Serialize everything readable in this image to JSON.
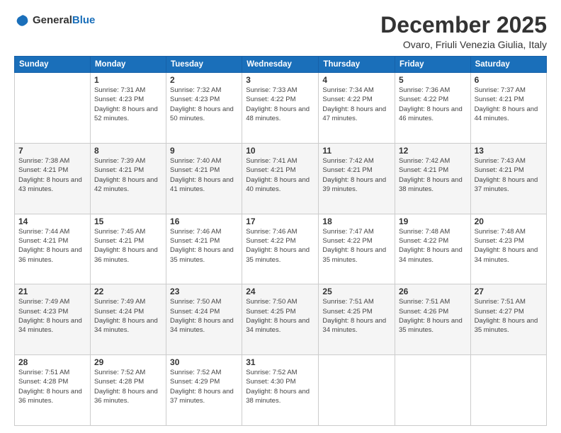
{
  "logo": {
    "general": "General",
    "blue": "Blue"
  },
  "header": {
    "month": "December 2025",
    "location": "Ovaro, Friuli Venezia Giulia, Italy"
  },
  "days_of_week": [
    "Sunday",
    "Monday",
    "Tuesday",
    "Wednesday",
    "Thursday",
    "Friday",
    "Saturday"
  ],
  "weeks": [
    [
      {
        "num": "",
        "sunrise": "",
        "sunset": "",
        "daylight": ""
      },
      {
        "num": "1",
        "sunrise": "Sunrise: 7:31 AM",
        "sunset": "Sunset: 4:23 PM",
        "daylight": "Daylight: 8 hours and 52 minutes."
      },
      {
        "num": "2",
        "sunrise": "Sunrise: 7:32 AM",
        "sunset": "Sunset: 4:23 PM",
        "daylight": "Daylight: 8 hours and 50 minutes."
      },
      {
        "num": "3",
        "sunrise": "Sunrise: 7:33 AM",
        "sunset": "Sunset: 4:22 PM",
        "daylight": "Daylight: 8 hours and 48 minutes."
      },
      {
        "num": "4",
        "sunrise": "Sunrise: 7:34 AM",
        "sunset": "Sunset: 4:22 PM",
        "daylight": "Daylight: 8 hours and 47 minutes."
      },
      {
        "num": "5",
        "sunrise": "Sunrise: 7:36 AM",
        "sunset": "Sunset: 4:22 PM",
        "daylight": "Daylight: 8 hours and 46 minutes."
      },
      {
        "num": "6",
        "sunrise": "Sunrise: 7:37 AM",
        "sunset": "Sunset: 4:21 PM",
        "daylight": "Daylight: 8 hours and 44 minutes."
      }
    ],
    [
      {
        "num": "7",
        "sunrise": "Sunrise: 7:38 AM",
        "sunset": "Sunset: 4:21 PM",
        "daylight": "Daylight: 8 hours and 43 minutes."
      },
      {
        "num": "8",
        "sunrise": "Sunrise: 7:39 AM",
        "sunset": "Sunset: 4:21 PM",
        "daylight": "Daylight: 8 hours and 42 minutes."
      },
      {
        "num": "9",
        "sunrise": "Sunrise: 7:40 AM",
        "sunset": "Sunset: 4:21 PM",
        "daylight": "Daylight: 8 hours and 41 minutes."
      },
      {
        "num": "10",
        "sunrise": "Sunrise: 7:41 AM",
        "sunset": "Sunset: 4:21 PM",
        "daylight": "Daylight: 8 hours and 40 minutes."
      },
      {
        "num": "11",
        "sunrise": "Sunrise: 7:42 AM",
        "sunset": "Sunset: 4:21 PM",
        "daylight": "Daylight: 8 hours and 39 minutes."
      },
      {
        "num": "12",
        "sunrise": "Sunrise: 7:42 AM",
        "sunset": "Sunset: 4:21 PM",
        "daylight": "Daylight: 8 hours and 38 minutes."
      },
      {
        "num": "13",
        "sunrise": "Sunrise: 7:43 AM",
        "sunset": "Sunset: 4:21 PM",
        "daylight": "Daylight: 8 hours and 37 minutes."
      }
    ],
    [
      {
        "num": "14",
        "sunrise": "Sunrise: 7:44 AM",
        "sunset": "Sunset: 4:21 PM",
        "daylight": "Daylight: 8 hours and 36 minutes."
      },
      {
        "num": "15",
        "sunrise": "Sunrise: 7:45 AM",
        "sunset": "Sunset: 4:21 PM",
        "daylight": "Daylight: 8 hours and 36 minutes."
      },
      {
        "num": "16",
        "sunrise": "Sunrise: 7:46 AM",
        "sunset": "Sunset: 4:21 PM",
        "daylight": "Daylight: 8 hours and 35 minutes."
      },
      {
        "num": "17",
        "sunrise": "Sunrise: 7:46 AM",
        "sunset": "Sunset: 4:22 PM",
        "daylight": "Daylight: 8 hours and 35 minutes."
      },
      {
        "num": "18",
        "sunrise": "Sunrise: 7:47 AM",
        "sunset": "Sunset: 4:22 PM",
        "daylight": "Daylight: 8 hours and 35 minutes."
      },
      {
        "num": "19",
        "sunrise": "Sunrise: 7:48 AM",
        "sunset": "Sunset: 4:22 PM",
        "daylight": "Daylight: 8 hours and 34 minutes."
      },
      {
        "num": "20",
        "sunrise": "Sunrise: 7:48 AM",
        "sunset": "Sunset: 4:23 PM",
        "daylight": "Daylight: 8 hours and 34 minutes."
      }
    ],
    [
      {
        "num": "21",
        "sunrise": "Sunrise: 7:49 AM",
        "sunset": "Sunset: 4:23 PM",
        "daylight": "Daylight: 8 hours and 34 minutes."
      },
      {
        "num": "22",
        "sunrise": "Sunrise: 7:49 AM",
        "sunset": "Sunset: 4:24 PM",
        "daylight": "Daylight: 8 hours and 34 minutes."
      },
      {
        "num": "23",
        "sunrise": "Sunrise: 7:50 AM",
        "sunset": "Sunset: 4:24 PM",
        "daylight": "Daylight: 8 hours and 34 minutes."
      },
      {
        "num": "24",
        "sunrise": "Sunrise: 7:50 AM",
        "sunset": "Sunset: 4:25 PM",
        "daylight": "Daylight: 8 hours and 34 minutes."
      },
      {
        "num": "25",
        "sunrise": "Sunrise: 7:51 AM",
        "sunset": "Sunset: 4:25 PM",
        "daylight": "Daylight: 8 hours and 34 minutes."
      },
      {
        "num": "26",
        "sunrise": "Sunrise: 7:51 AM",
        "sunset": "Sunset: 4:26 PM",
        "daylight": "Daylight: 8 hours and 35 minutes."
      },
      {
        "num": "27",
        "sunrise": "Sunrise: 7:51 AM",
        "sunset": "Sunset: 4:27 PM",
        "daylight": "Daylight: 8 hours and 35 minutes."
      }
    ],
    [
      {
        "num": "28",
        "sunrise": "Sunrise: 7:51 AM",
        "sunset": "Sunset: 4:28 PM",
        "daylight": "Daylight: 8 hours and 36 minutes."
      },
      {
        "num": "29",
        "sunrise": "Sunrise: 7:52 AM",
        "sunset": "Sunset: 4:28 PM",
        "daylight": "Daylight: 8 hours and 36 minutes."
      },
      {
        "num": "30",
        "sunrise": "Sunrise: 7:52 AM",
        "sunset": "Sunset: 4:29 PM",
        "daylight": "Daylight: 8 hours and 37 minutes."
      },
      {
        "num": "31",
        "sunrise": "Sunrise: 7:52 AM",
        "sunset": "Sunset: 4:30 PM",
        "daylight": "Daylight: 8 hours and 38 minutes."
      },
      {
        "num": "",
        "sunrise": "",
        "sunset": "",
        "daylight": ""
      },
      {
        "num": "",
        "sunrise": "",
        "sunset": "",
        "daylight": ""
      },
      {
        "num": "",
        "sunrise": "",
        "sunset": "",
        "daylight": ""
      }
    ]
  ]
}
